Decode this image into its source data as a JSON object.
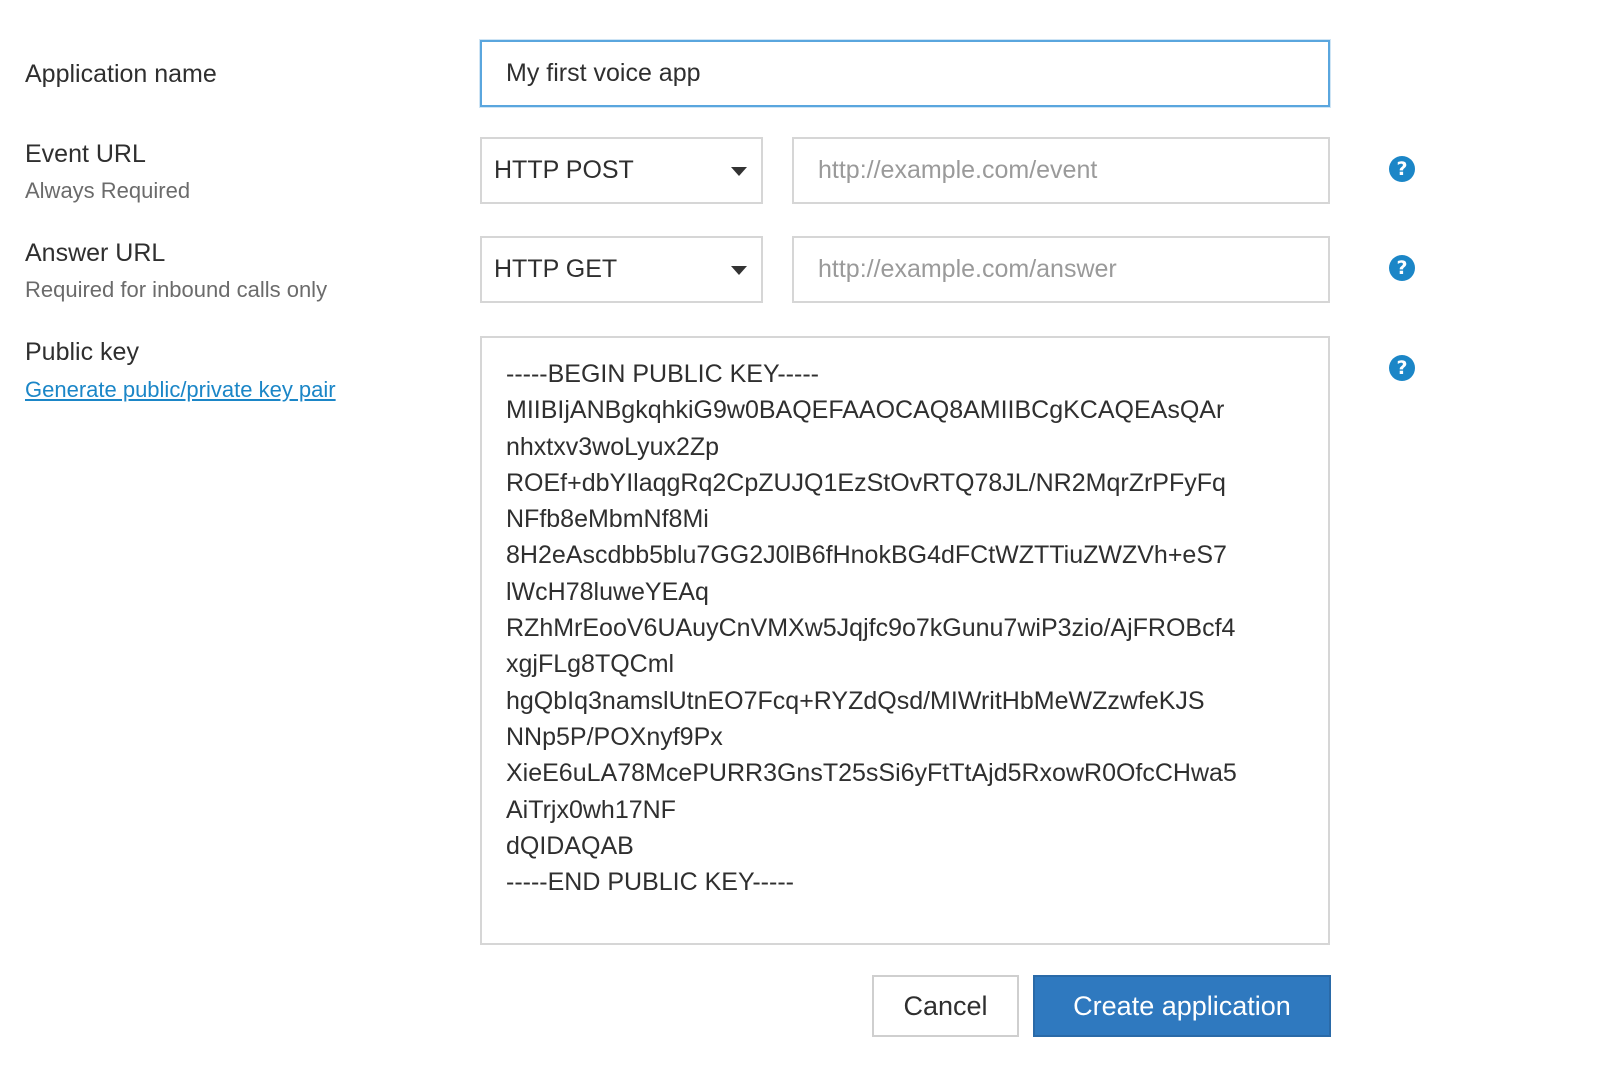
{
  "form": {
    "app_name": {
      "label": "Application name",
      "value": "My first voice app"
    },
    "event_url": {
      "label": "Event URL",
      "sublabel": "Always Required",
      "method": "HTTP POST",
      "placeholder": "http://example.com/event",
      "value": ""
    },
    "answer_url": {
      "label": "Answer URL",
      "sublabel": "Required for inbound calls only",
      "method": "HTTP GET",
      "placeholder": "http://example.com/answer",
      "value": ""
    },
    "public_key": {
      "label": "Public key",
      "link": "Generate public/private key pair",
      "value": "-----BEGIN PUBLIC KEY-----\nMIIBIjANBgkqhkiG9w0BAQEFAAOCAQ8AMIIBCgKCAQEAsQAr\nnhxtxv3woLyux2Zp\nROEf+dbYIlaqgRq2CpZUJQ1EzStOvRTQ78JL/NR2MqrZrPFyFq\nNFfb8eMbmNf8Mi\n8H2eAscdbb5blu7GG2J0lB6fHnokBG4dFCtWZTTiuZWZVh+eS7\nlWcH78luweYEAq\nRZhMrEooV6UAuyCnVMXw5Jqjfc9o7kGunu7wiP3zio/AjFROBcf4\nxgjFLg8TQCml\nhgQbIq3namslUtnEO7Fcq+RYZdQsd/MIWritHbMeWZzwfeKJS\nNNp5P/POXnyf9Px\nXieE6uLA78McePURR3GnsT25sSi6yFtTtAjd5RxowR0OfcCHwa5\nAiTrjx0wh17NF\ndQIDAQAB\n-----END PUBLIC KEY-----"
    },
    "help_icon": "?"
  },
  "actions": {
    "cancel_label": "Cancel",
    "create_label": "Create application"
  },
  "colors": {
    "primary": "#2f79bf",
    "link": "#1b86c7",
    "focus_border": "#5aa6de"
  }
}
